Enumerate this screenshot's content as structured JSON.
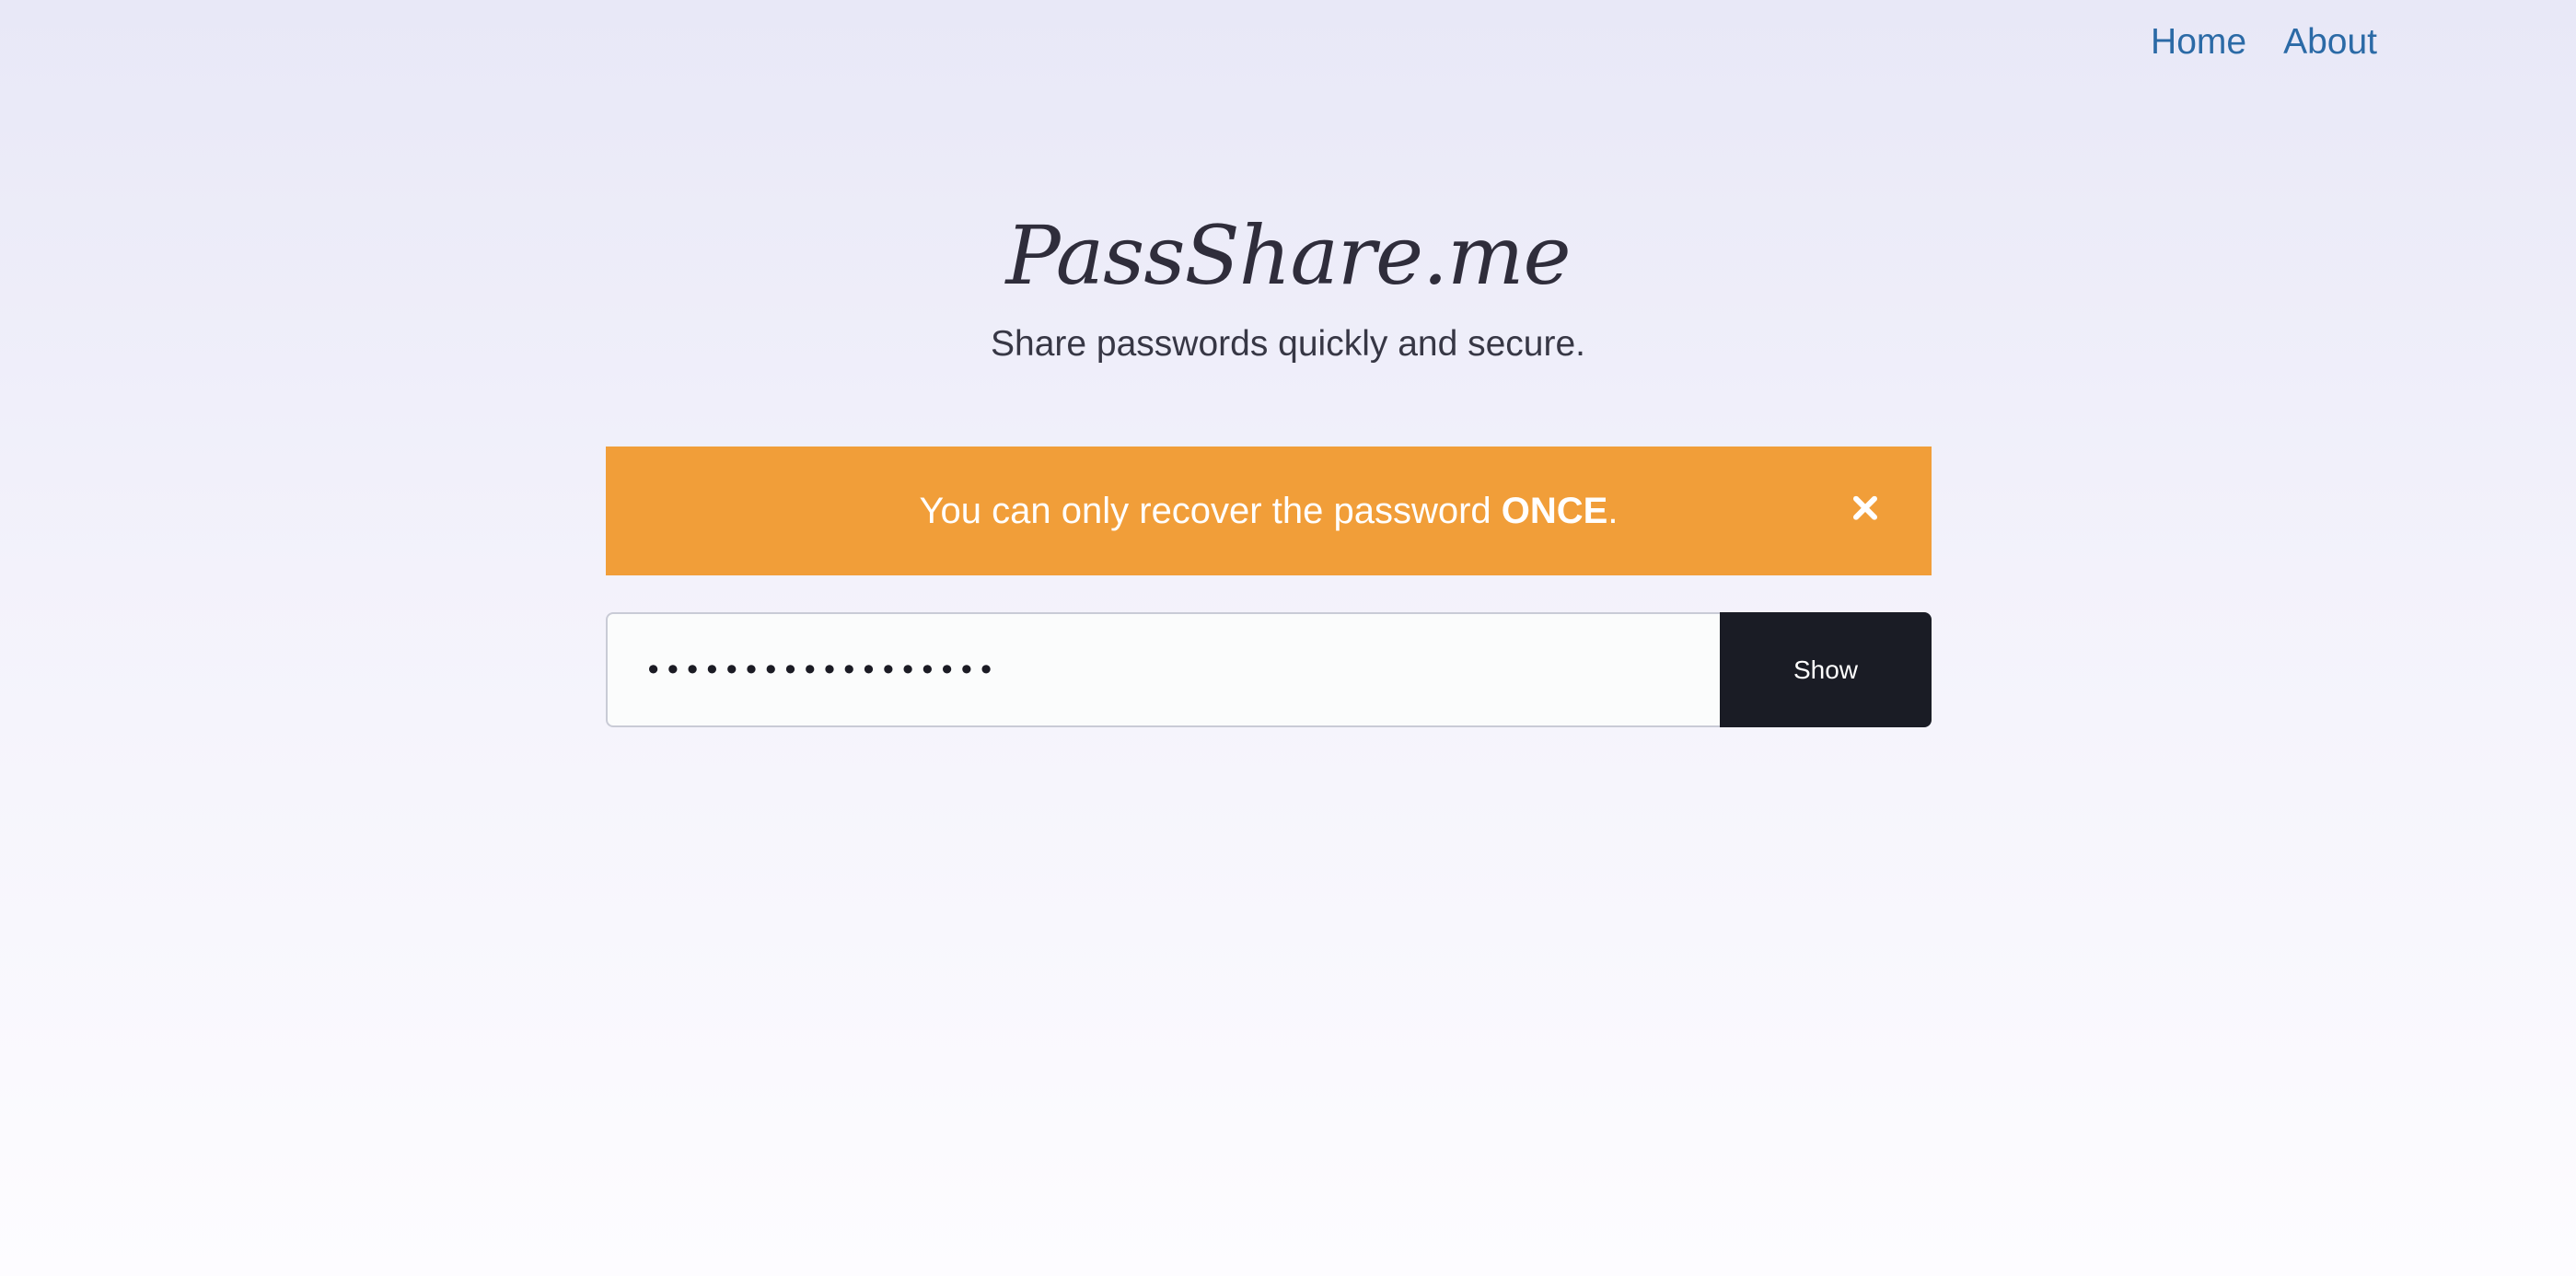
{
  "nav": {
    "home_label": "Home",
    "about_label": "About",
    "link_color": "#2b6aa6"
  },
  "hero": {
    "brand": "PassShare.me",
    "tagline": "Share passwords quickly and secure."
  },
  "alert": {
    "text_before": "You can only recover the password ",
    "text_emphasis": "ONCE",
    "text_after": ".",
    "close_icon": "close-icon",
    "background_color": "#f19e39"
  },
  "password": {
    "masked_value": "••••••••••••••••••",
    "show_label": "Show",
    "button_color": "#1a1c25"
  }
}
